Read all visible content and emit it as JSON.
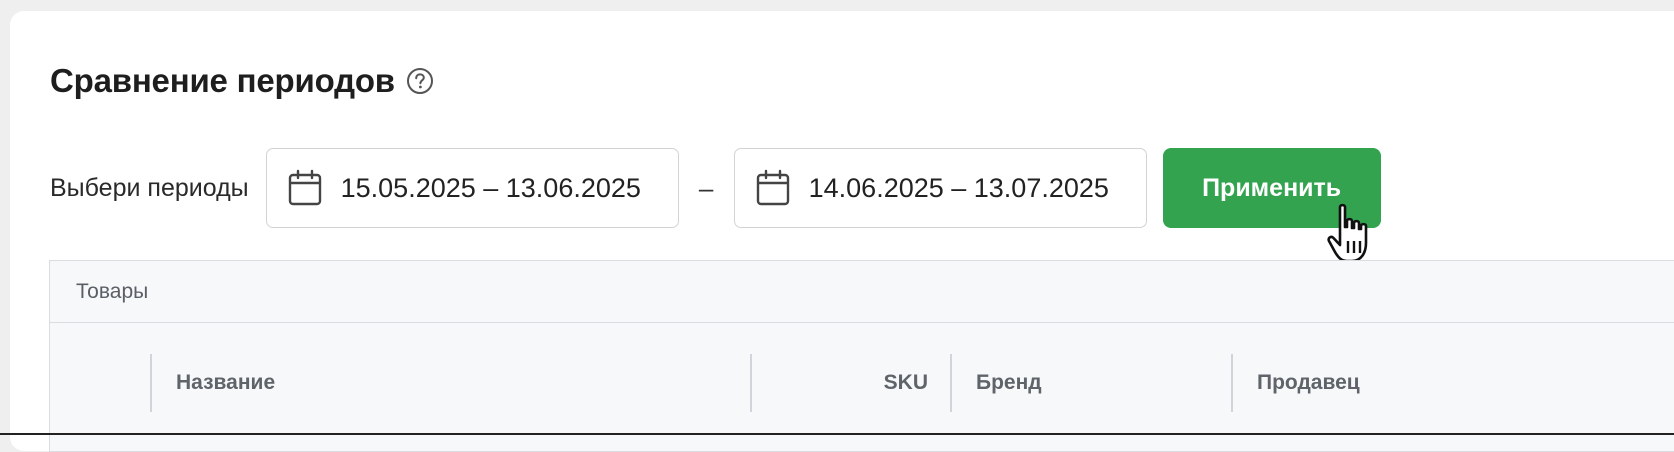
{
  "page": {
    "title": "Сравнение периодов",
    "title_icon": "help-circle-icon"
  },
  "filters": {
    "period_label": "Выбери периоды",
    "period1": "15.05.2025 – 13.06.2025",
    "separator": "–",
    "period2": "14.06.2025 – 13.07.2025",
    "apply_label": "Применить",
    "date_icon": "calendar-icon",
    "accent_color": "#33a350"
  },
  "table": {
    "caption": "Товары",
    "columns": [
      "Название",
      "SKU",
      "Бренд",
      "Продавец"
    ]
  },
  "cursor": {
    "icon": "hand-pointer-icon"
  }
}
